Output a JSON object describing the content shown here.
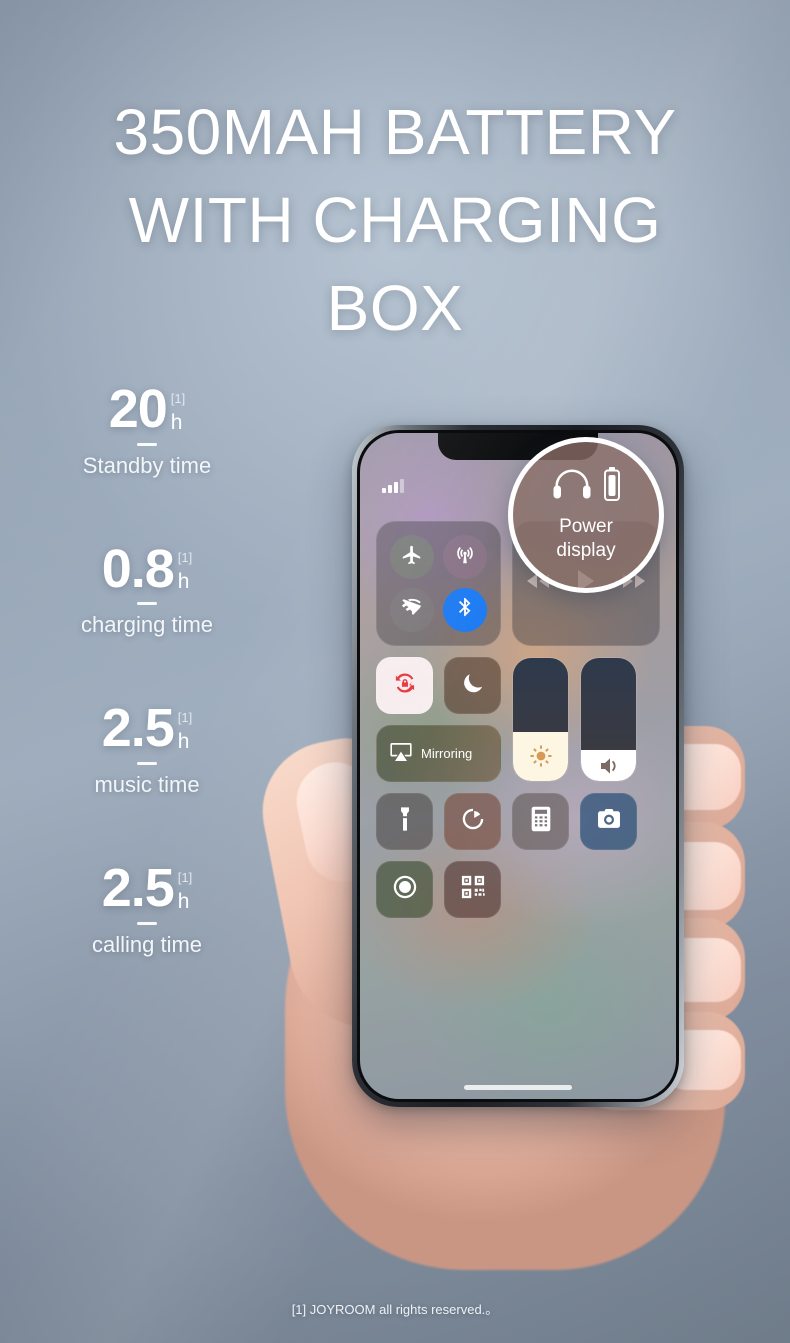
{
  "headline": {
    "line1": "350MAH BATTERY",
    "line2": "WITH CHARGING",
    "line3": "BOX"
  },
  "stats": [
    {
      "value": "20",
      "sup": "[1]",
      "unit": "h",
      "label": "Standby time"
    },
    {
      "value": "0.8",
      "sup": "[1]",
      "unit": "h",
      "label": "charging time"
    },
    {
      "value": "2.5",
      "sup": "[1]",
      "unit": "h",
      "label": "music time"
    },
    {
      "value": "2.5",
      "sup": "[1]",
      "unit": "h",
      "label": "calling time"
    }
  ],
  "badge": {
    "line1": "Power",
    "line2": "display",
    "icons": [
      "headphones-icon",
      "battery-icon"
    ],
    "fill_color": "#8b6e67",
    "ring_color": "#ffffff"
  },
  "phone": {
    "status_bar": {
      "signal_icon": "signal-bars-icon",
      "bars_filled": 3,
      "bars_total": 4
    },
    "control_center": {
      "connectivity": [
        {
          "name": "airplane-mode-toggle",
          "icon": "airplane-icon",
          "state": "off"
        },
        {
          "name": "cellular-data-toggle",
          "icon": "cellular-icon",
          "state": "off"
        },
        {
          "name": "wifi-toggle",
          "icon": "wifi-off-icon",
          "state": "off"
        },
        {
          "name": "bluetooth-toggle",
          "icon": "bluetooth-icon",
          "state": "on",
          "color": "#1d7bf2"
        }
      ],
      "media": [
        {
          "name": "rewind-button",
          "icon": "rewind-icon"
        },
        {
          "name": "play-button",
          "icon": "play-icon"
        },
        {
          "name": "fast-forward-button",
          "icon": "fast-forward-icon"
        }
      ],
      "rotation_lock": {
        "icon": "rotation-lock-icon",
        "state": "on",
        "accent": "#e8373b"
      },
      "do_not_disturb": {
        "icon": "moon-icon",
        "state": "off"
      },
      "mirroring": {
        "label": "Mirroring",
        "icon": "airplay-icon"
      },
      "brightness_slider": {
        "icon": "brightness-icon",
        "value_percent": 40
      },
      "volume_slider": {
        "icon": "volume-icon",
        "value_percent": 25
      },
      "shortcuts": [
        {
          "name": "flashlight-button",
          "icon": "flashlight-icon"
        },
        {
          "name": "timer-button",
          "icon": "timer-icon"
        },
        {
          "name": "calculator-button",
          "icon": "calculator-icon"
        },
        {
          "name": "camera-button",
          "icon": "camera-icon"
        },
        {
          "name": "screen-record-button",
          "icon": "record-icon"
        },
        {
          "name": "qr-scanner-button",
          "icon": "qr-code-icon"
        }
      ]
    }
  },
  "footer": {
    "text": "[1] JOYROOM all rights reserved.。"
  }
}
